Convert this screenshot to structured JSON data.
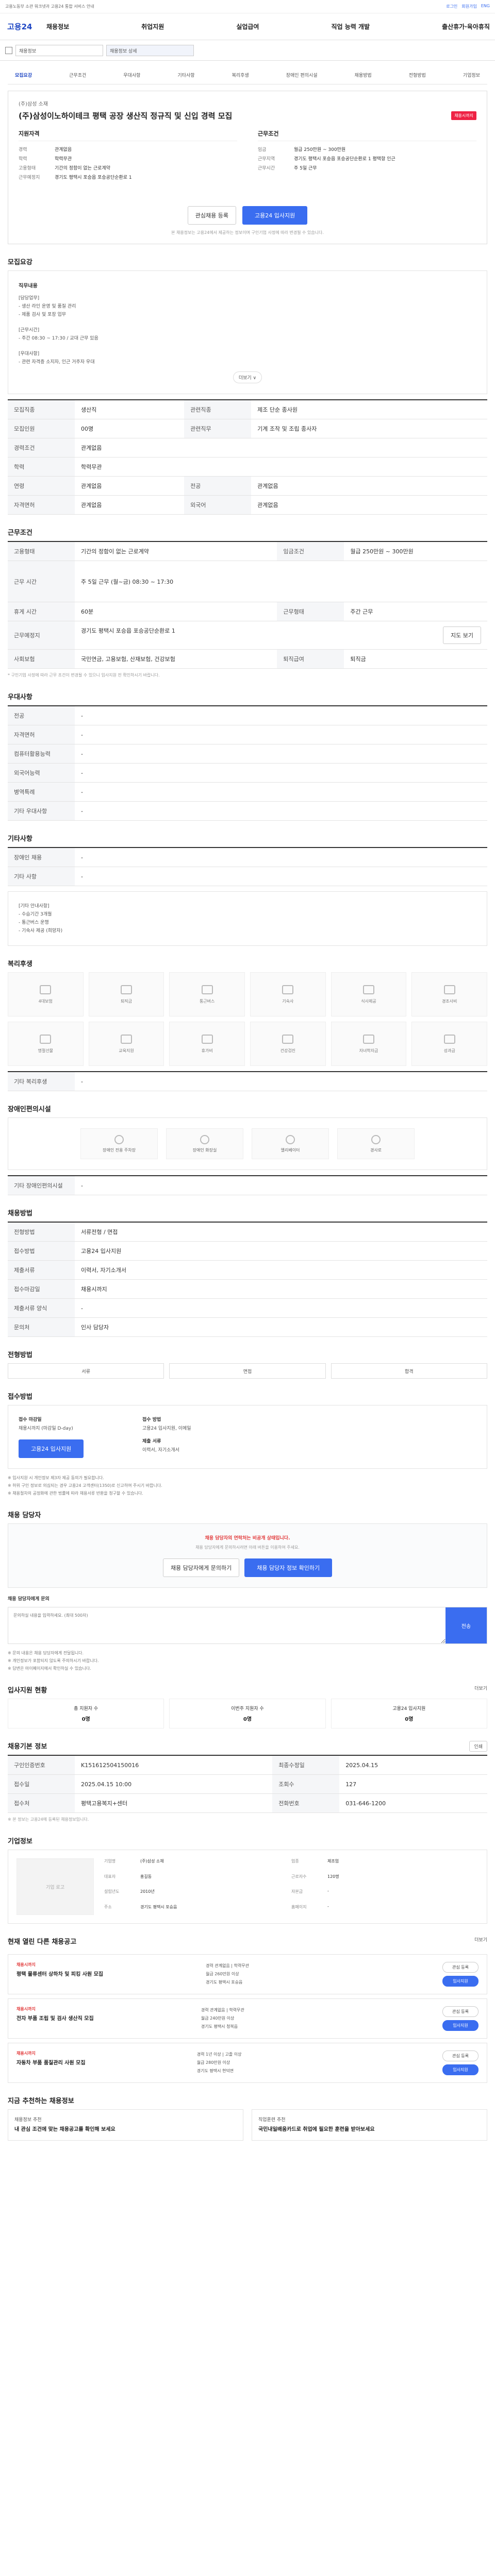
{
  "topbar": {
    "left": "고용노동부 소관 워크넷과 고용24 통합 서비스 안내",
    "links": [
      "로그인",
      "회원가입",
      "ENG"
    ]
  },
  "gnb": {
    "logo": "고용24",
    "menus": [
      "채용정보",
      "취업지원",
      "실업급여",
      "직업 능력 개발",
      "출산휴가·육아휴직"
    ]
  },
  "subnav": {
    "sel1": "채용정보",
    "sel2": "채용정보 상세"
  },
  "tabs": [
    "모집요강",
    "근무조건",
    "우대사항",
    "기타사항",
    "복리후생",
    "장애인 편의시설",
    "채용방법",
    "전형방법",
    "기업정보"
  ],
  "header": {
    "corp": "(주)삼성 소재",
    "title": "(주)삼성이노하이테크 평택 공장 생산직 정규직 및 신입 경력 모집",
    "dday": "채용시까지",
    "left_head": "지원자격",
    "left_rows": [
      [
        "경력",
        "관계없음"
      ],
      [
        "학력",
        "학력무관"
      ],
      [
        "",
        ""
      ],
      [
        "고용형태",
        "기간의 정함이 없는 근로계약"
      ],
      [
        "근무예정지",
        "경기도 평택시 포승읍 포승공단순환로 1"
      ]
    ],
    "right_head": "근무조건",
    "right_rows": [
      [
        "임금",
        "월급 250만원 ~ 300만원"
      ],
      [
        "근무지역",
        "경기도 평택시 포승읍 포승공단순환로 1 평택항 인근"
      ],
      [
        "",
        ""
      ],
      [
        "근무시간",
        "주 5일 근무"
      ]
    ]
  },
  "head_actions": {
    "save": "관심채용 등록",
    "apply": "고용24 입사지원"
  },
  "head_note": "본 채용정보는 고용24에서 제공하는 정보이며 구인기업 사정에 따라 변경될 수 있습니다.",
  "recruit": {
    "title": "모집요강",
    "job_label": "직무내용",
    "job_lines": [
      "[담당업무]",
      "- 생산 라인 운영 및 품질 관리",
      "- 제품 검사 및 포장 업무",
      "",
      "[근무시간]",
      "- 주간 08:30 ~ 17:30 / 교대 근무 있음",
      "",
      "[우대사항]",
      "- 관련 자격증 소지자, 인근 거주자 우대"
    ],
    "more": "더보기 ∨",
    "rows": [
      [
        "모집직종",
        "생산직",
        "관련직종",
        "제조 단순 종사원"
      ],
      [
        "모집인원",
        "00명",
        "관련직무",
        "기계 조작 및 조립 종사자"
      ],
      [
        "경력조건",
        "관계없음",
        "",
        ""
      ],
      [
        "학력",
        "학력무관",
        "",
        ""
      ],
      [
        "연령",
        "관계없음",
        "전공",
        "관계없음"
      ],
      [
        "자격면허",
        "관계없음",
        "외국어",
        "관계없음"
      ]
    ]
  },
  "work": {
    "title": "근무조건",
    "rows": [
      [
        "고용형태",
        "기간의 정함이 없는 근로계약",
        "임금조건",
        "월급 250만원 ~ 300만원"
      ],
      [
        "근무 시간",
        "주 5일 근무 (월~금) 08:30 ~ 17:30",
        "",
        ""
      ],
      [
        "휴게 시간",
        "60분",
        "근무형태",
        "주간 근무"
      ],
      [
        "근무예정지",
        "경기도 평택시 포승읍 포승공단순환로 1",
        "",
        ""
      ],
      [
        "사회보험",
        "국민연금, 고용보험, 산재보험, 건강보험",
        "퇴직급여",
        "퇴직금"
      ]
    ],
    "map_btn": "지도 보기",
    "note": "* 구인기업 사정에 따라 근무 조건이 변경될 수 있으니 입사지원 전 확인하시기 바랍니다."
  },
  "pref": {
    "title": "우대사항",
    "rows": [
      [
        "전공",
        "-"
      ],
      [
        "자격면허",
        "-"
      ],
      [
        "컴퓨터활용능력",
        "-"
      ],
      [
        "외국어능력",
        "-"
      ],
      [
        "병역특례",
        "-"
      ],
      [
        "기타 우대사항",
        "-"
      ]
    ]
  },
  "etc": {
    "title": "기타사항",
    "rows": [
      [
        "장애인 채용",
        "-"
      ],
      [
        "기타 사항",
        "-"
      ]
    ],
    "lines": [
      "[기타 안내사항]",
      "- 수습기간 3개월",
      "- 통근버스 운행",
      "- 기숙사 제공 (희망자)"
    ]
  },
  "benefit": {
    "title": "복리후생",
    "items": [
      "4대보험",
      "퇴직금",
      "통근버스",
      "기숙사",
      "식사제공",
      "경조사비",
      "명절선물",
      "교육지원",
      "휴가비",
      "건강검진",
      "자녀학자금",
      "성과급"
    ],
    "etc_label": "기타 복리후생",
    "etc_value": "-"
  },
  "facility": {
    "title": "장애인편의시설",
    "items": [
      "장애인 전용 주차장",
      "장애인 화장실",
      "엘리베이터",
      "경사로"
    ],
    "etc_label": "기타 장애인편의시설",
    "etc_value": "-"
  },
  "method": {
    "title": "채용방법",
    "rows": [
      [
        "전형방법",
        "서류전형 / 면접"
      ],
      [
        "접수방법",
        "고용24 입사지원"
      ],
      [
        "제출서류",
        "이력서, 자기소개서"
      ],
      [
        "접수마감일",
        "채용시까지"
      ],
      [
        "제출서류 양식",
        "-"
      ],
      [
        "문의처",
        "인사 담당자"
      ]
    ]
  },
  "screening": {
    "title": "전형방법",
    "items": [
      "서류",
      "면접",
      "합격"
    ]
  },
  "receipt": {
    "title": "접수방법",
    "k1": "접수 마감일",
    "v1": "채용시까지 (마감일 D-day)",
    "k2": "접수 방법",
    "v2": "고용24 입사지원, 이메일",
    "k3": "제출 서류",
    "v3": "이력서, 자기소개서",
    "apply_btn": "고용24 입사지원",
    "notes": [
      "※ 입사지원 시 개인정보 제3자 제공 동의가 필요합니다.",
      "※ 허위 구인 정보로 의심되는 경우 고용24 고객센터(1350)로 신고하여 주시기 바랍니다.",
      "※ 채용절차의 공정화에 관한 법률에 따라 채용서류 반환을 청구할 수 있습니다."
    ]
  },
  "contact": {
    "title": "채용 담당자",
    "alert": "채용 담당자의 연락처는 비공개 상태입니다.",
    "alert_sub": "채용 담당자에게 문의하시려면 아래 버튼을 이용하여 주세요.",
    "btn1": "채용 담당자에게 문의하기",
    "btn2": "채용 담당자 정보 확인하기",
    "inquiry_label": "채용 담당자에게 문의",
    "inquiry_placeholder": "문의하실 내용을 입력하세요. (최대 500자)",
    "inquiry_submit": "전송",
    "notes": [
      "※ 문의 내용은 채용 담당자에게 전달됩니다.",
      "※ 개인정보가 포함되지 않도록 주의하시기 바랍니다.",
      "※ 답변은 마이페이지에서 확인하실 수 있습니다."
    ]
  },
  "status": {
    "title": "입사지원 현황",
    "more": "더보기",
    "items": [
      [
        "총 지원자 수",
        "0명"
      ],
      [
        "이번주 지원자 수",
        "0명"
      ],
      [
        "고용24 입사지원",
        "0명"
      ]
    ]
  },
  "info": {
    "title": "채용기본 정보",
    "print": "인쇄",
    "rows": [
      [
        "구인인증번호",
        "K151612504150016",
        "최종수정일",
        "2025.04.15"
      ],
      [
        "접수일",
        "2025.04.15 10:00",
        "조회수",
        "127"
      ],
      [
        "접수처",
        "평택고용복지+센터",
        "전화번호",
        "031-646-1200"
      ]
    ],
    "note": "※ 본 정보는 고용24에 등록된 채용정보입니다."
  },
  "company": {
    "title": "기업정보",
    "logo": "기업 로고",
    "rows": [
      [
        "기업명",
        "(주)삼성 소재",
        "업종",
        "제조업"
      ],
      [
        "대표자",
        "홍길동",
        "근로자수",
        "120명"
      ],
      [
        "설립년도",
        "2010년",
        "자본금",
        "-"
      ],
      [
        "주소",
        "경기도 평택시 포승읍",
        "홈페이지",
        "-"
      ]
    ]
  },
  "similar": {
    "title": "현재 열린 다른 채용공고",
    "more": "더보기",
    "jobs": [
      {
        "tag": "채용시까지",
        "title": "평택 물류센터 상하차 및 피킹 사원 모집",
        "lines": [
          "경력 관계없음 | 학력무관",
          "월급 260만원 이상",
          "경기도 평택시 포승읍"
        ],
        "btn1": "관심 등록",
        "btn2": "입사지원"
      },
      {
        "tag": "채용시까지",
        "title": "전자 부품 조립 및 검사 생산직 모집",
        "lines": [
          "경력 관계없음 | 학력무관",
          "월급 240만원 이상",
          "경기도 평택시 청북읍"
        ],
        "btn1": "관심 등록",
        "btn2": "입사지원"
      },
      {
        "tag": "채용시까지",
        "title": "자동차 부품 품질관리 사원 모집",
        "lines": [
          "경력 1년 이상 | 고졸 이상",
          "월급 280만원 이상",
          "경기도 평택시 현덕면"
        ],
        "btn1": "관심 등록",
        "btn2": "입사지원"
      }
    ]
  },
  "recommend": {
    "title": "지금 추천하는 채용정보",
    "banners": [
      {
        "t": "채용정보 추천",
        "h": "내 관심 조건에 맞는 채용공고를 확인해 보세요"
      },
      {
        "t": "직업훈련 추천",
        "h": "국민내일배움카드로 취업에 필요한 훈련을 받아보세요"
      }
    ]
  }
}
